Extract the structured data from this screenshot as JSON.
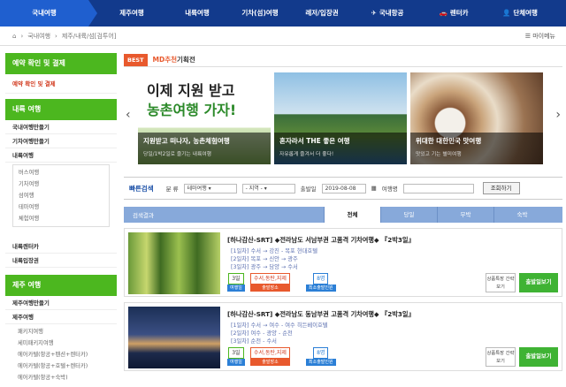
{
  "topnav": {
    "items": [
      {
        "label": "국내여행",
        "active": true
      },
      {
        "label": "제주여행"
      },
      {
        "label": "내륙여행"
      },
      {
        "label": "기차(섬)여행"
      },
      {
        "label": "레저/입장권"
      },
      {
        "label": "국내항공",
        "icon": "airplane-icon"
      },
      {
        "label": "렌터카",
        "icon": "car-icon"
      },
      {
        "label": "단체여행",
        "icon": "person-icon"
      }
    ]
  },
  "breadcrumb": {
    "home_icon": "home-icon",
    "level1": "국내여행",
    "level2": "제주/내륙/섬[검투어]",
    "mypage": "마이메뉴"
  },
  "sidebar": {
    "group1_title": "예약 확인 및 결제",
    "group1_link": "예약 확인 및 결제",
    "group2_title": "내륙 여행",
    "items_a": [
      "국내여행만들기",
      "기차여행만들기",
      "내륙여행"
    ],
    "sub_items": [
      "버스여행",
      "기차여행",
      "섬여행",
      "테마여행",
      "체험여행"
    ],
    "items_b": [
      "내륙렌터카",
      "내륙입장권"
    ],
    "group3_title": "제주 여행",
    "items_c": [
      "제주여행만들기",
      "제주여행"
    ],
    "sub_items2": [
      "패키지여행",
      "세미패키지여행",
      "에어카텔(항공+펜션+렌터카)",
      "에어카텔(항공+호텔+렌터카)",
      "에어카텔(항공+숙박)"
    ]
  },
  "best": {
    "tag": "BEST",
    "md_label": "MD추천",
    "md_suffix": "기획전"
  },
  "slides": [
    {
      "headline1": "이제 지원 받고",
      "headline2": "농촌여행 가자!",
      "caption": "지원받고 떠나자, 농촌체험여행",
      "sub": "당일/1박2일로 즐기는 내륙여행"
    },
    {
      "caption": "혼자라서 THE 좋은 여행",
      "sub": "자유롭게 즐겨서 더 좋다!"
    },
    {
      "caption": "위대한 대한민국 맛여행",
      "sub": "맛있고 기는 별미여행"
    }
  ],
  "quick_search": {
    "label": "빠른검색",
    "cat_label": "분 류",
    "cat_value": "테마여행",
    "region_value": "- 지역 -",
    "date_label": "출발일",
    "date_value": "2019-08-08",
    "name_label": "여행명",
    "name_value": "",
    "button": "조회하기"
  },
  "result_tabs": {
    "result_label": "검색결과",
    "tabs": [
      "전체",
      "당일",
      "무박",
      "숙박"
    ]
  },
  "products": [
    {
      "title": "[하나감산-SRT] ◆전라남도 서남부권 고품격 기차여행◆ 『2박3일』",
      "days": [
        "[1일차] 수서 → 강진 - 목포 현대호텔",
        "[2일차] 목포 → 신안 → 광주",
        "[3일차] 광주 → 담양 → 수서"
      ],
      "badges": [
        {
          "top": "3일",
          "bottom": "여행일"
        },
        {
          "top": "수서,동탄,지제",
          "bottom": "출발장소"
        },
        {
          "top": "8명",
          "bottom": "최소출발인원"
        }
      ],
      "compare": "상품특장 간략보기",
      "book": "출발일보기"
    },
    {
      "title": "[하나감산-SRT] ◆전라남도 동남부권 고품격 기차여행◆ 『2박3일』",
      "days": [
        "[1일차] 수서 → 여수 - 여수 히든베이호텔",
        "[2일차] 여수 - 광양 - 순천",
        "[3일차] 순천 - 수서"
      ],
      "badges": [
        {
          "top": "3일",
          "bottom": "여행일"
        },
        {
          "top": "수서,동탄,지제",
          "bottom": "출발장소"
        },
        {
          "top": "8명",
          "bottom": "최소출발인원"
        }
      ],
      "compare": "상품특장 간략보기",
      "book": "출발일보기"
    }
  ]
}
